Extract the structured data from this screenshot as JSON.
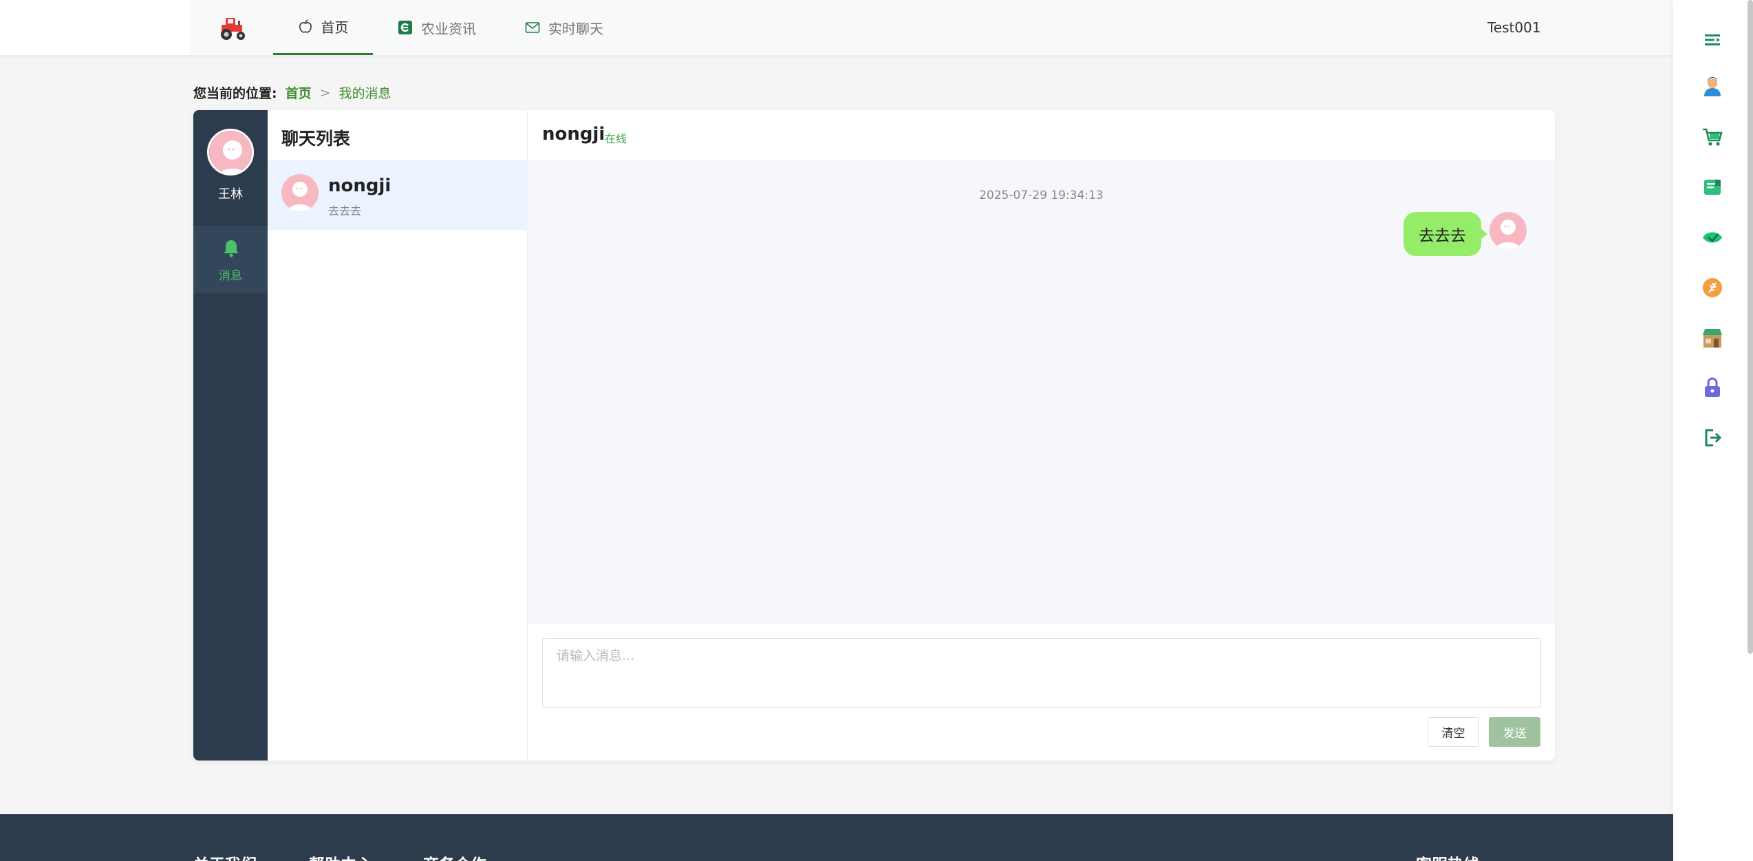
{
  "nav": {
    "items": [
      {
        "label": "首页",
        "icon": "apple-icon",
        "active": true
      },
      {
        "label": "农业资讯",
        "icon": "news-icon",
        "active": false
      },
      {
        "label": "实时聊天",
        "icon": "mail-icon",
        "active": false
      }
    ],
    "username": "Test001"
  },
  "breadcrumb": {
    "label": "您当前的位置:",
    "home": "首页",
    "separator": ">",
    "current": "我的消息"
  },
  "sidebar": {
    "user_name": "王林",
    "menu_label": "消息"
  },
  "chat_list": {
    "title": "聊天列表",
    "conversations": [
      {
        "name": "nongji",
        "last_message": "去去去"
      }
    ]
  },
  "chat": {
    "contact_name": "nongji",
    "status": "在线",
    "messages": [
      {
        "timestamp": "2025-07-29 19:34:13",
        "text": "去去去",
        "from_me": true
      }
    ],
    "input_placeholder": "请输入消息...",
    "clear_label": "清空",
    "send_label": "发送"
  },
  "footer": {
    "links": [
      "关于我们",
      "帮助中心",
      "商务合作",
      "客服热线"
    ]
  },
  "rail": {
    "icons": [
      "menu-icon",
      "user-icon",
      "cart-icon",
      "notes-icon",
      "leaf-icon",
      "wheat-icon",
      "shop-icon",
      "lock-icon",
      "logout-icon"
    ]
  },
  "colors": {
    "accent_green": "#3a8d2a",
    "sidebar_bg": "#2d3c4d",
    "bubble_green": "#95ec69",
    "send_button": "#9ec39e"
  }
}
